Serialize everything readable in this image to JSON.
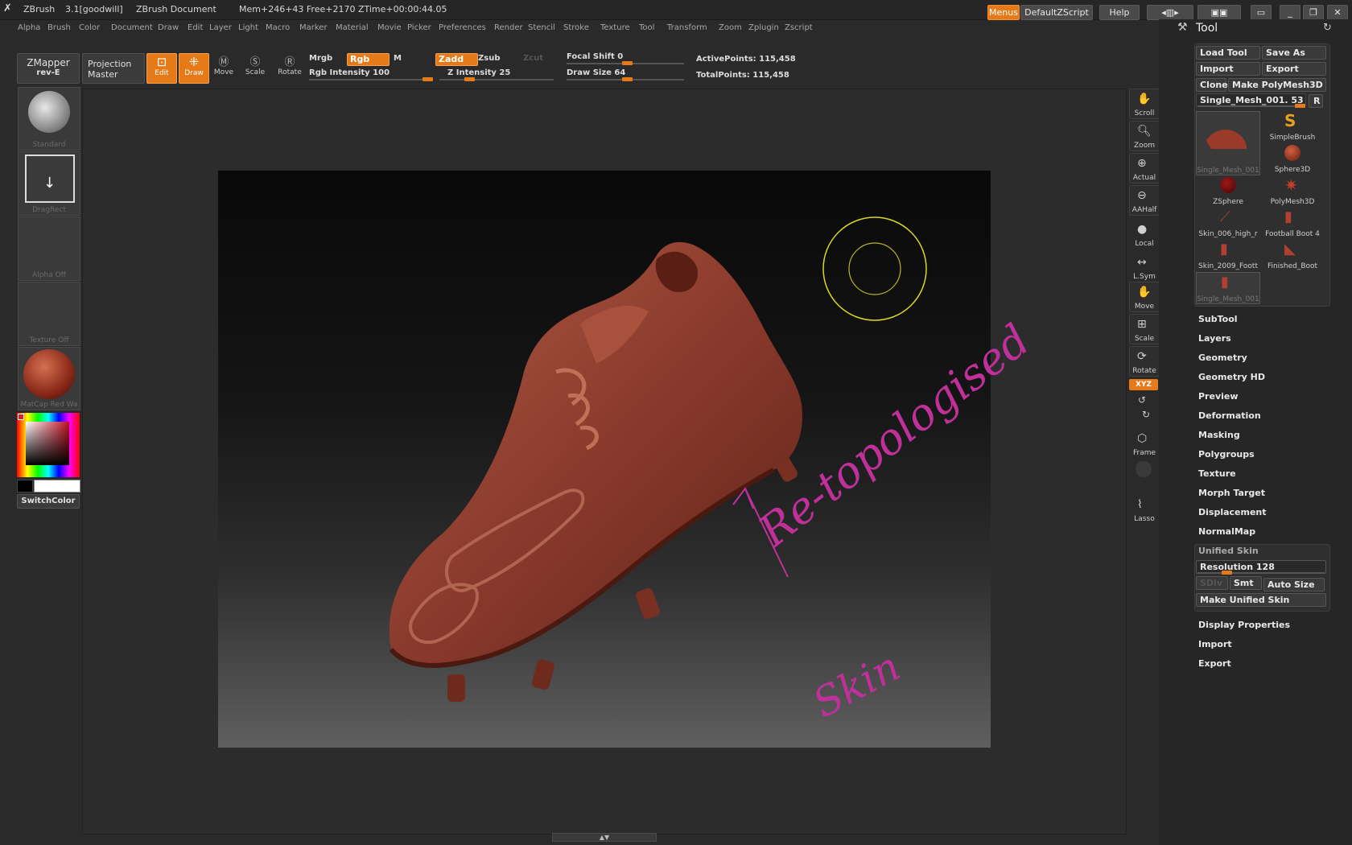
{
  "titlebar": {
    "app": "ZBrush",
    "version": "3.1[goodwill]",
    "doc": "ZBrush Document",
    "stats": "Mem+246+43  Free+2170  ZTime+00:00:44.05",
    "menus": "Menus",
    "script": "DefaultZScript",
    "help": "Help"
  },
  "menubar": [
    "Alpha",
    "Brush",
    "Color",
    "Document",
    "Draw",
    "Edit",
    "Layer",
    "Light",
    "Macro",
    "Marker",
    "Material",
    "Movie",
    "Picker",
    "Preferences",
    "Render",
    "Stencil",
    "Stroke",
    "Texture",
    "Tool",
    "Transform",
    "Zoom",
    "Zplugin",
    "Zscript"
  ],
  "shelf": {
    "zmapper": "ZMapper",
    "zmapper_sub": "rev-E",
    "projection": "Projection",
    "projection_sub": "Master",
    "edit": "Edit",
    "draw": "Draw",
    "move": "Move",
    "scale": "Scale",
    "rotate": "Rotate",
    "mrgb": "Mrgb",
    "rgb": "Rgb",
    "m": "M",
    "rgb_intensity": "Rgb Intensity 100",
    "zadd": "Zadd",
    "zsub": "Zsub",
    "zcut": "Zcut",
    "z_intensity": "Z Intensity 25",
    "focal_shift": "Focal Shift 0",
    "draw_size": "Draw Size 64",
    "active_points": "ActivePoints: 115,458",
    "total_points": "TotalPoints: 115,458"
  },
  "left": {
    "standard": "Standard",
    "dragrect": "DragRect",
    "alpha": "Alpha  Off",
    "texture": "Texture  Off",
    "matcap": "MatCap  Red  Wa",
    "switchcolor": "SwitchColor"
  },
  "viewport": {
    "annotation_line1": "Re-topologised",
    "annotation_line2": "Skin"
  },
  "righttools": [
    "Scroll",
    "Zoom",
    "Actual",
    "AAHalf",
    "Local",
    "L.Sym",
    "Move",
    "Scale",
    "Rotate",
    "XYZ",
    "Frame",
    "Lasso"
  ],
  "toolpanel": {
    "title": "Tool",
    "load_tool": "Load Tool",
    "save_as": "Save As",
    "import": "Import",
    "export": "Export",
    "clone": "Clone",
    "make_polymesh": "Make PolyMesh3D",
    "current_tool": "Single_Mesh_001. 53",
    "r": "R",
    "tools": [
      {
        "label": "Single_Mesh_001"
      },
      {
        "label": "SimpleBrush"
      },
      {
        "label": "Sphere3D"
      },
      {
        "label": "ZSphere"
      },
      {
        "label": "PolyMesh3D"
      },
      {
        "label": "Skin_006_high_r"
      },
      {
        "label": "Football Boot 4"
      },
      {
        "label": "Skin_2009_Foott"
      },
      {
        "label": "Finished_Boot"
      },
      {
        "label": "Single_Mesh_001"
      }
    ],
    "sections": [
      "SubTool",
      "Layers",
      "Geometry",
      "Geometry HD",
      "Preview",
      "Deformation",
      "Masking",
      "Polygroups",
      "Texture",
      "Morph Target",
      "Displacement",
      "NormalMap"
    ],
    "unified_skin": "Unified Skin",
    "resolution": "Resolution 128",
    "sdiv": "SDiv",
    "smt": "Smt",
    "auto_size": "Auto Size",
    "make_unified": "Make Unified Skin",
    "display_properties": "Display Properties",
    "import2": "Import",
    "export2": "Export"
  },
  "colors": {
    "accent": "#e67a18",
    "clay": "#8a3a2c",
    "annotation": "#c0309a",
    "cursor": "#d8d820"
  }
}
